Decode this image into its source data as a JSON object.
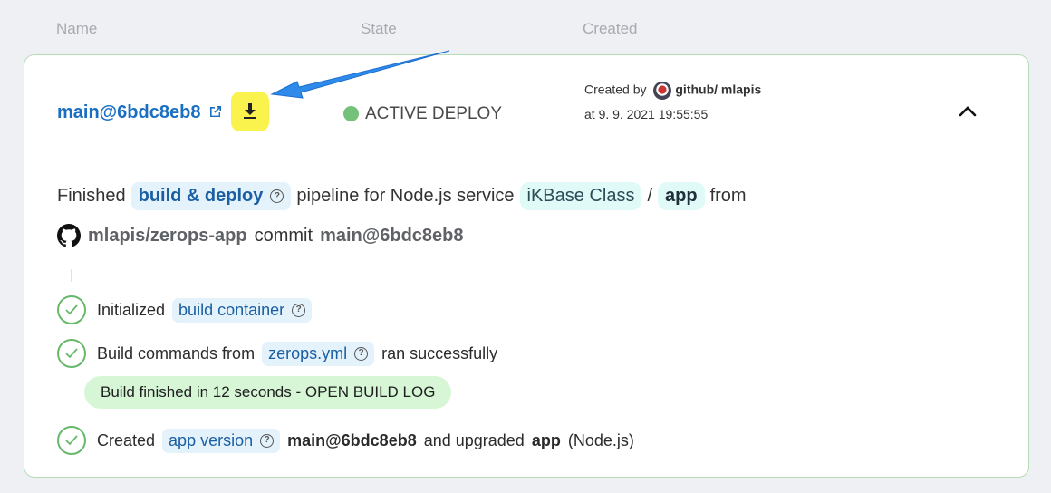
{
  "columns": {
    "name": "Name",
    "state": "State",
    "created": "Created"
  },
  "row": {
    "version": "main@6bdc8eb8",
    "state": "ACTIVE DEPLOY",
    "state_color": "#74c27a",
    "created_by_label": "Created by",
    "created_by_source": "github/",
    "created_by_user": "mlapis",
    "created_at": "at 9. 9. 2021 19:55:55"
  },
  "pipeline": {
    "finished_label": "Finished",
    "pipeline_chip": "build & deploy",
    "pipeline_text": "pipeline for Node.js service",
    "project": "iKBase Class",
    "separator": "/",
    "service": "app",
    "from_label": "from",
    "repo": "mlapis/zerops-app",
    "commit_label": "commit",
    "commit": "main@6bdc8eb8"
  },
  "steps": [
    {
      "prefix": "Initialized",
      "chip": "build container"
    },
    {
      "prefix": "Build commands from",
      "chip": "zerops.yml",
      "suffix": "ran successfully"
    },
    {
      "prefix": "Created",
      "chip": "app version",
      "version": "main@6bdc8eb8",
      "middle": "and upgraded",
      "service": "app",
      "runtime": "(Node.js)"
    }
  ],
  "build_log": {
    "text": "Build finished in 12 seconds  - OPEN BUILD LOG"
  },
  "icons": [
    "external-link-icon",
    "download-icon",
    "chevron-up-icon",
    "help-icon",
    "github-icon",
    "check-circle-icon"
  ],
  "colors": {
    "accent": "#1a6fc2",
    "highlight": "#fbf34d",
    "success": "#67b86b"
  }
}
